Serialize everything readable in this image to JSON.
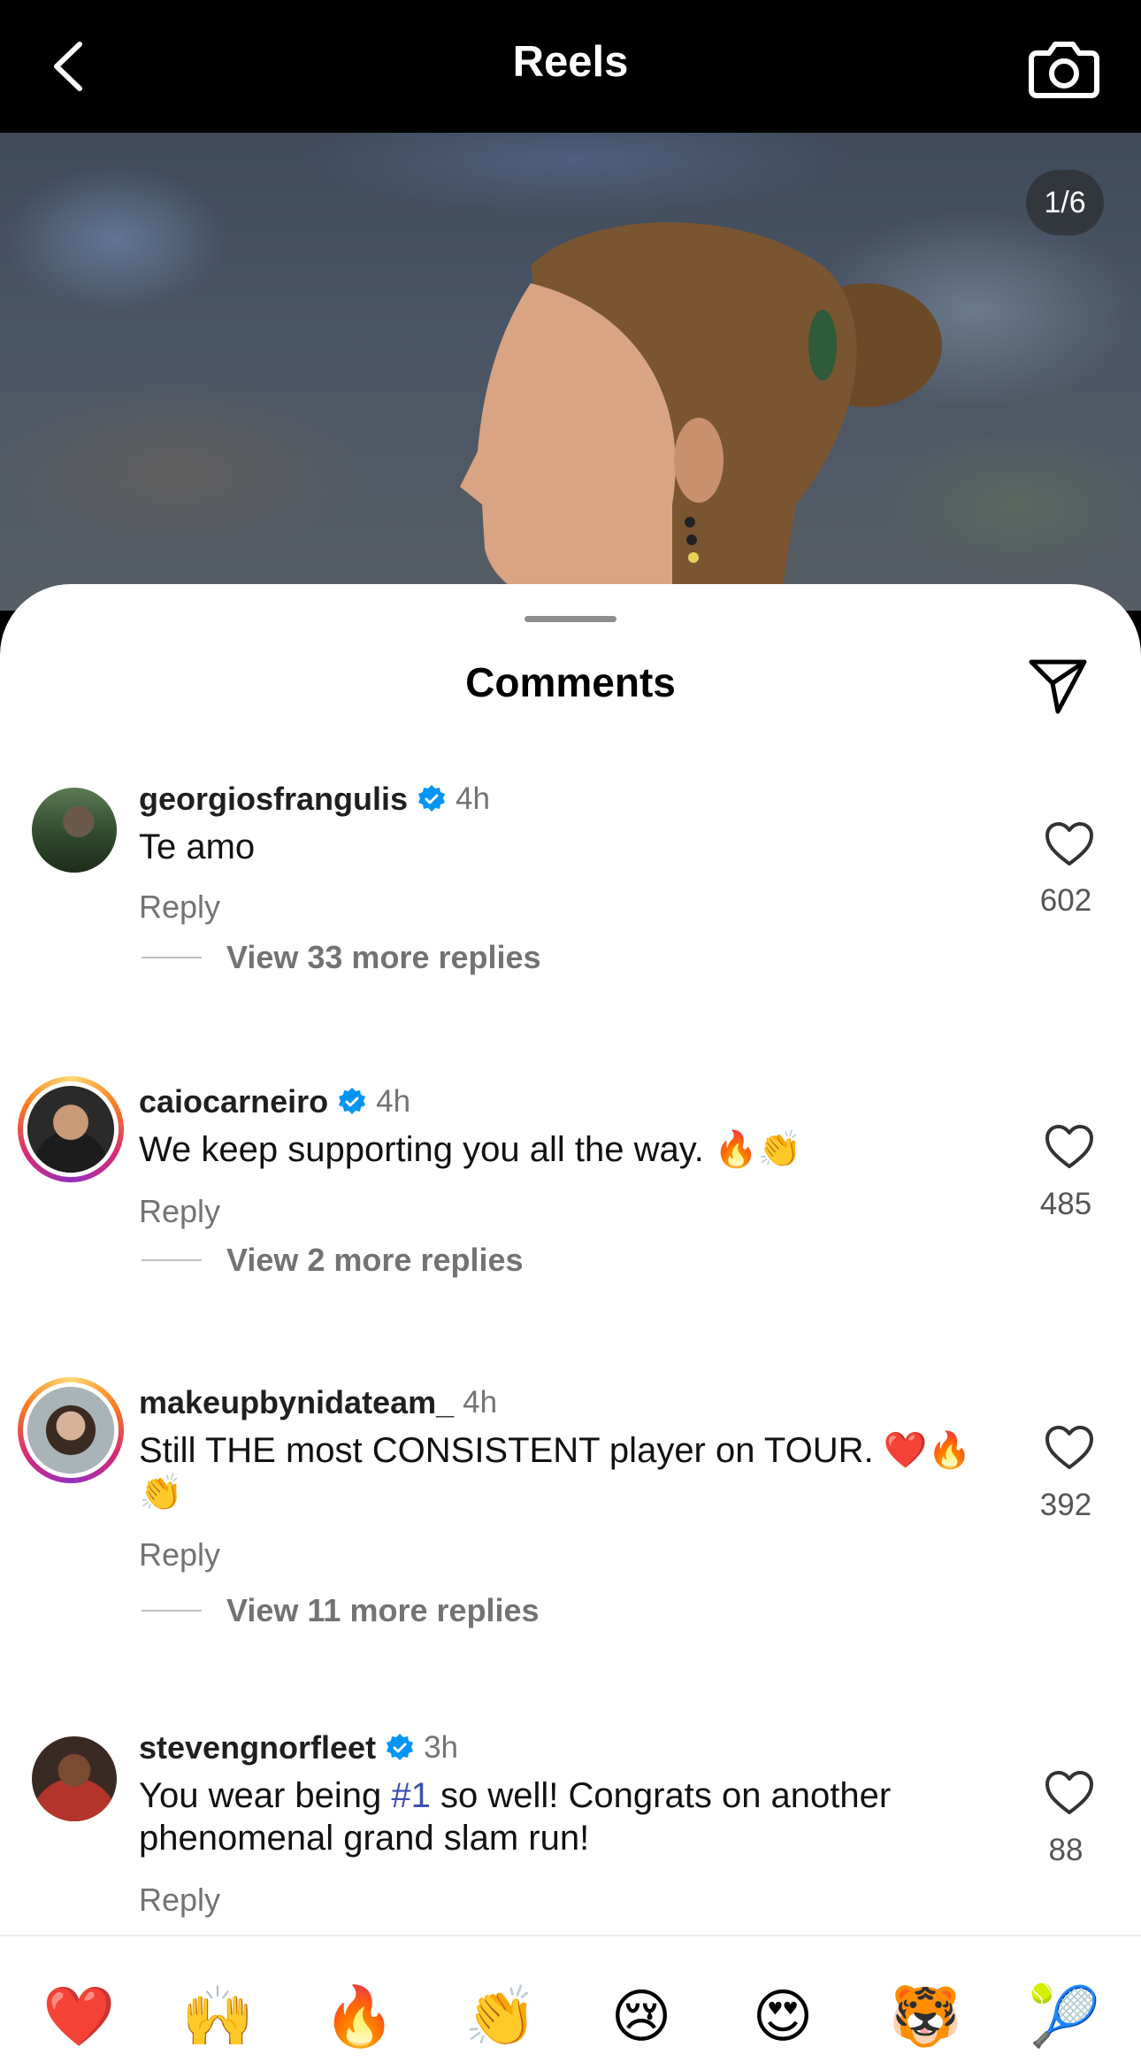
{
  "header": {
    "title": "Reels",
    "back_icon": "chevron-left-icon",
    "camera_icon": "camera-icon"
  },
  "reel": {
    "counter": "1/6"
  },
  "sheet": {
    "title": "Comments",
    "share_icon": "paper-plane-icon"
  },
  "comments": [
    {
      "username": "georgiosfrangulis",
      "verified": true,
      "time": "4h",
      "text": "Te amo",
      "reply": "Reply",
      "likes": "602",
      "view_replies": "View 33 more replies"
    },
    {
      "username": "caiocarneiro",
      "verified": true,
      "time": "4h",
      "text": "We keep supporting you all the way. 🔥👏",
      "reply": "Reply",
      "likes": "485",
      "view_replies": "View 2 more replies"
    },
    {
      "username": "makeupbynidateam_",
      "verified": false,
      "time": "4h",
      "text": "Still THE most CONSISTENT player on TOUR. ❤️🔥👏",
      "reply": "Reply",
      "likes": "392",
      "view_replies": "View 11 more replies"
    },
    {
      "username": "stevengnorfleet",
      "verified": true,
      "time": "3h",
      "text_before": "You wear being ",
      "hashtag": "#1",
      "text_after": " so well! Congrats on another phenomenal grand slam run!",
      "reply": "Reply",
      "likes": "88"
    }
  ],
  "emoji_bar": [
    "❤️",
    "🙌",
    "🔥",
    "👏",
    "😢",
    "😍",
    "🐯",
    "🎾"
  ]
}
